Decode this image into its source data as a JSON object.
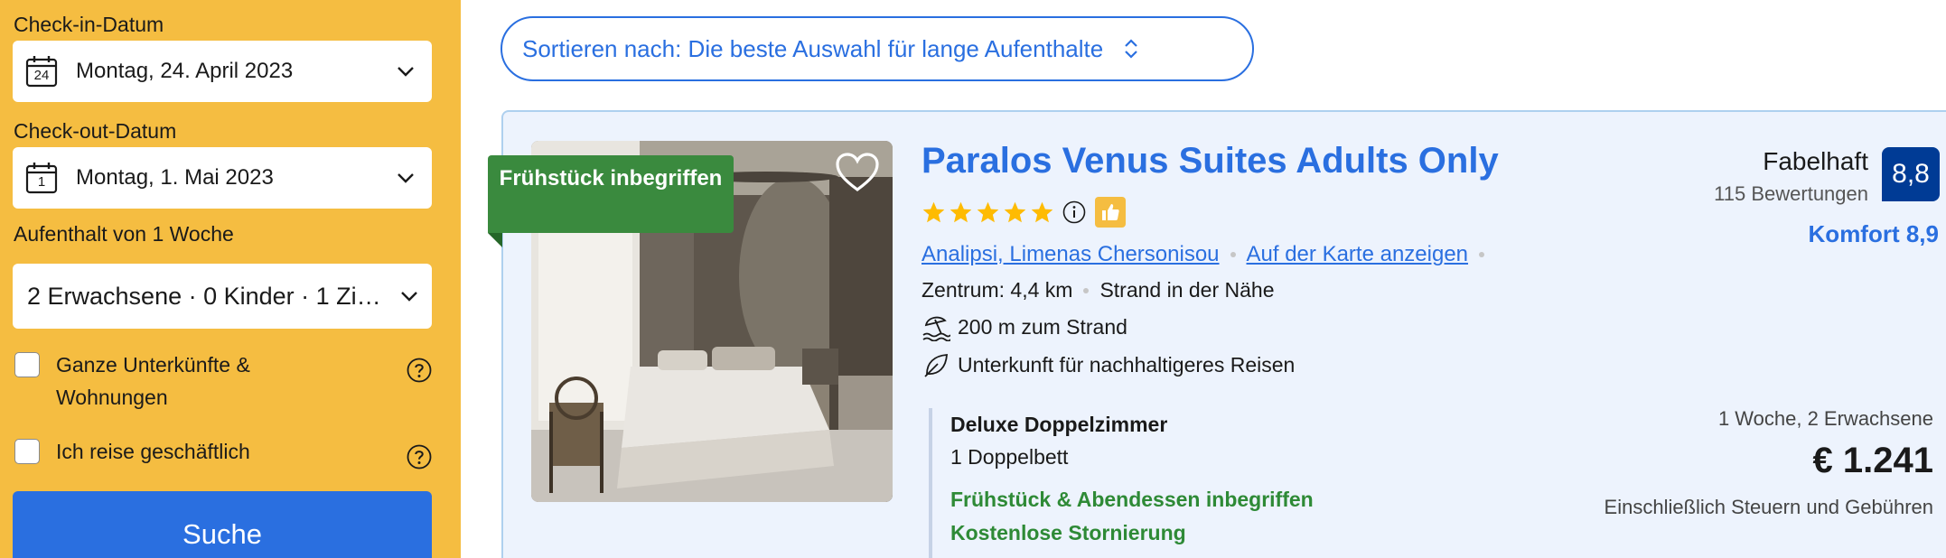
{
  "sidebar": {
    "checkin_label": "Check-in-Datum",
    "checkin_day": "24",
    "checkin_value": "Montag, 24. April 2023",
    "checkout_label": "Check-out-Datum",
    "checkout_day": "1",
    "checkout_value": "Montag, 1. Mai 2023",
    "stay_label": "Aufenthalt von 1 Woche",
    "guests_value": "2 Erwachsene · 0 Kinder · 1 Zimmer",
    "options": [
      {
        "label": "Ganze Unterkünfte & Wohnungen",
        "checked": false
      },
      {
        "label": "Ich reise geschäftlich",
        "checked": false
      }
    ],
    "search_label": "Suche"
  },
  "sort": {
    "label": "Sortieren nach: Die beste Auswahl für lange Aufenthalte"
  },
  "hotel": {
    "badge": "Frühstück inbegriffen",
    "name": "Paralos Venus Suites Adults Only",
    "stars": 5,
    "location_link": "Analipsi, Limenas Chersonisou",
    "map_link": "Auf der Karte anzeigen",
    "center_distance": "Zentrum: 4,4 km",
    "beach_near": "Strand in der Nähe",
    "beach_distance": "200 m zum Strand",
    "sustainable": "Unterkunft für nachhaltigeres Reisen",
    "review_word": "Fabelhaft",
    "review_count": "115 Bewertungen",
    "score": "8,8",
    "comfort": "Komfort 8,9",
    "room": {
      "title": "Deluxe Doppelzimmer",
      "bed": "1 Doppelbett",
      "meals": "Frühstück & Abendessen inbegriffen",
      "cancellation": "Kostenlose Stornierung"
    },
    "price_meta": "1 Woche, 2 Erwachsene",
    "price": "€ 1.241",
    "taxes": "Einschließlich Steuern und Gebühren"
  },
  "colors": {
    "sidebar_bg": "#f5bd41",
    "accent_blue": "#2a6fe0",
    "score_blue": "#003b95",
    "green": "#2e8a36"
  }
}
